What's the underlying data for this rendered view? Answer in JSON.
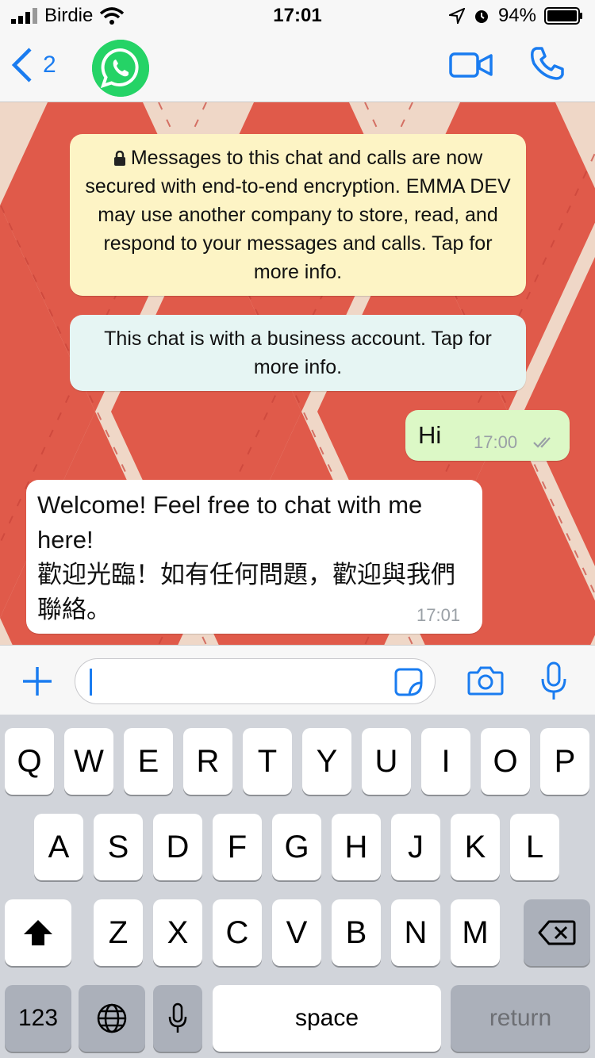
{
  "status_bar": {
    "carrier": "Birdie",
    "time": "17:01",
    "battery": "94%"
  },
  "nav": {
    "back_count": "2",
    "avatar_icon": "whatsapp-logo-icon",
    "video_icon": "video-camera-icon",
    "call_icon": "phone-icon"
  },
  "chat": {
    "encryption_notice": "Messages to this chat and calls are now secured with end-to-end encryption. EMMA DEV may use another company to store, read, and respond to your messages and calls. Tap for more info.",
    "business_notice": "This chat is with a business account. Tap for more info.",
    "messages": [
      {
        "direction": "outgoing",
        "text": "Hi",
        "time": "17:00",
        "status": "read"
      },
      {
        "direction": "incoming",
        "text_line1": "Welcome! Feel free to chat with me here!",
        "text_line2": "歡迎光臨！如有任何問題，歡迎與我們聯絡。",
        "time": "17:01"
      }
    ]
  },
  "input": {
    "value": "",
    "icons": [
      "plus-icon",
      "sticker-icon",
      "camera-icon",
      "microphone-icon"
    ]
  },
  "keyboard": {
    "row1": [
      "Q",
      "W",
      "E",
      "R",
      "T",
      "Y",
      "U",
      "I",
      "O",
      "P"
    ],
    "row2": [
      "A",
      "S",
      "D",
      "F",
      "G",
      "H",
      "J",
      "K",
      "L"
    ],
    "row3": [
      "Z",
      "X",
      "C",
      "V",
      "B",
      "N",
      "M"
    ],
    "numbers_label": "123",
    "space_label": "space",
    "return_label": "return"
  },
  "colors": {
    "accent": "#1a7cf0",
    "whatsapp_green": "#25d366",
    "outgoing_bubble": "#dcf8c6",
    "notice_yellow": "#fdf4c5",
    "notice_teal": "#e6f5f3",
    "pattern_red": "#e05a4a"
  }
}
